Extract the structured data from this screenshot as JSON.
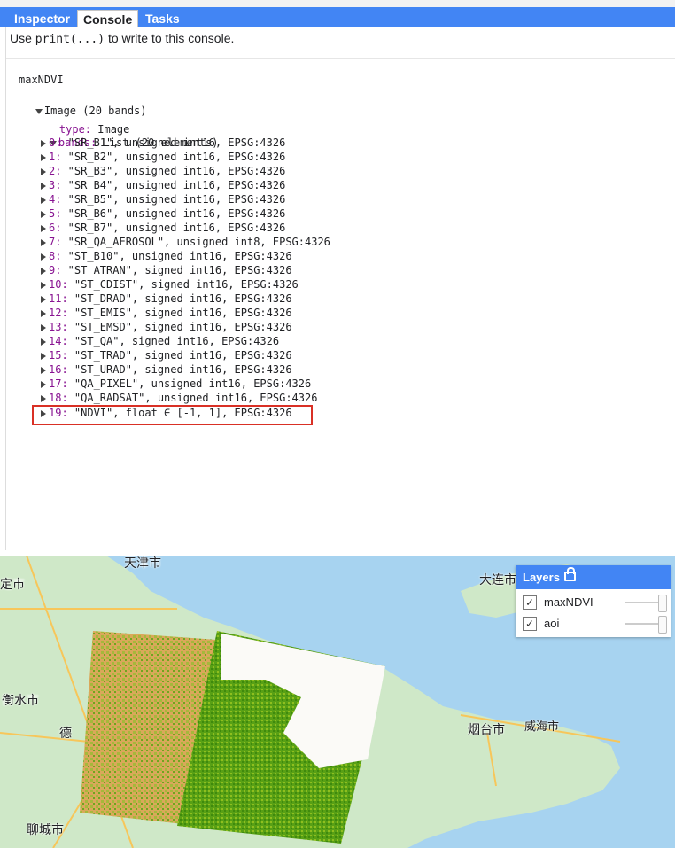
{
  "tabs": [
    {
      "label": "Inspector"
    },
    {
      "label": "Console"
    },
    {
      "label": "Tasks"
    }
  ],
  "console": {
    "hint_prefix": "Use ",
    "hint_code": "print(...)",
    "hint_suffix": " to write to this console.",
    "var_name": "maxNDVI",
    "image_header": "Image (20 bands)",
    "type_key": "type:",
    "type_value": " Image",
    "bands_key": "bands:",
    "bands_value": " List (20 elements)",
    "bands": [
      {
        "idx": "0:",
        "text": " \"SR_B1\", unsigned int16, EPSG:4326"
      },
      {
        "idx": "1:",
        "text": " \"SR_B2\", unsigned int16, EPSG:4326"
      },
      {
        "idx": "2:",
        "text": " \"SR_B3\", unsigned int16, EPSG:4326"
      },
      {
        "idx": "3:",
        "text": " \"SR_B4\", unsigned int16, EPSG:4326"
      },
      {
        "idx": "4:",
        "text": " \"SR_B5\", unsigned int16, EPSG:4326"
      },
      {
        "idx": "5:",
        "text": " \"SR_B6\", unsigned int16, EPSG:4326"
      },
      {
        "idx": "6:",
        "text": " \"SR_B7\", unsigned int16, EPSG:4326"
      },
      {
        "idx": "7:",
        "text": " \"SR_QA_AEROSOL\", unsigned int8, EPSG:4326"
      },
      {
        "idx": "8:",
        "text": " \"ST_B10\", unsigned int16, EPSG:4326"
      },
      {
        "idx": "9:",
        "text": " \"ST_ATRAN\", signed int16, EPSG:4326"
      },
      {
        "idx": "10:",
        "text": " \"ST_CDIST\", signed int16, EPSG:4326"
      },
      {
        "idx": "11:",
        "text": " \"ST_DRAD\", signed int16, EPSG:4326"
      },
      {
        "idx": "12:",
        "text": " \"ST_EMIS\", signed int16, EPSG:4326"
      },
      {
        "idx": "13:",
        "text": " \"ST_EMSD\", signed int16, EPSG:4326"
      },
      {
        "idx": "14:",
        "text": " \"ST_QA\", signed int16, EPSG:4326"
      },
      {
        "idx": "15:",
        "text": " \"ST_TRAD\", signed int16, EPSG:4326"
      },
      {
        "idx": "16:",
        "text": " \"ST_URAD\", signed int16, EPSG:4326"
      },
      {
        "idx": "17:",
        "text": " \"QA_PIXEL\", unsigned int16, EPSG:4326"
      },
      {
        "idx": "18:",
        "text": " \"QA_RADSAT\", unsigned int16, EPSG:4326"
      },
      {
        "idx": "19:",
        "text": " \"NDVI\", float ∈ [-1, 1], EPSG:4326"
      }
    ]
  },
  "map": {
    "labels": [
      {
        "text": "天津市"
      },
      {
        "text": "定市"
      },
      {
        "text": "大连市"
      },
      {
        "text": "衡水市"
      },
      {
        "text": "德"
      },
      {
        "text": "烟台市"
      },
      {
        "text": "威海市"
      },
      {
        "text": "聊城市"
      }
    ]
  },
  "layers": {
    "title": "Layers",
    "items": [
      {
        "name": "maxNDVI",
        "checked": "✓"
      },
      {
        "name": "aoi",
        "checked": "✓"
      }
    ]
  },
  "colors": {
    "accent": "#4285f4",
    "highlight_box": "#d93025",
    "key_purple": "#881391",
    "water": "#a7d3f0",
    "land": "#cfe8c8"
  }
}
